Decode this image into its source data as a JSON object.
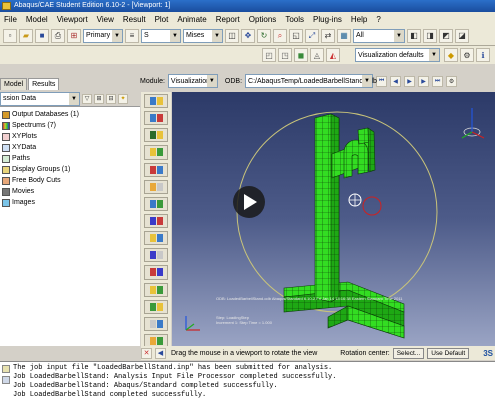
{
  "window": {
    "title": "Abaqus/CAE Student Edition 6.10-2 - [Viewport: 1]"
  },
  "menu": {
    "items": [
      "File",
      "Model",
      "Viewport",
      "View",
      "Result",
      "Plot",
      "Animate",
      "Report",
      "Options",
      "Tools",
      "Plug-ins",
      "Help",
      "?"
    ]
  },
  "toolbar": {
    "step_combo": "Primary",
    "frame_combo": "S",
    "field_combo": "Mises",
    "render_combo": "All",
    "viz_defaults": "Visualization defaults"
  },
  "context": {
    "module_label": "Module:",
    "module_value": "Visualization",
    "odb_label": "ODB:",
    "odb_value": "C:/AbaqusTemp/LoadedBarbellStand.odb"
  },
  "left_panel": {
    "tabs": [
      "Model",
      "Results"
    ],
    "active_tab": "Results",
    "selector_value": "ssion Data",
    "tree": [
      {
        "label": "Output Databases (1)",
        "icon": "database-icon",
        "color": "#d49a2a"
      },
      {
        "label": "Spectrums (7)",
        "icon": "spectrum-icon",
        "color": "#7a5cc4"
      },
      {
        "label": "XYPlots",
        "icon": "xyplot-icon",
        "color": "#c83a3a"
      },
      {
        "label": "XYData",
        "icon": "xydata-icon",
        "color": "#3a7ac8"
      },
      {
        "label": "Paths",
        "icon": "path-icon",
        "color": "#4aa04a"
      },
      {
        "label": "Display Groups (1)",
        "icon": "display-group-icon",
        "color": "#d4b02a"
      },
      {
        "label": "Free Body Cuts",
        "icon": "free-body-icon",
        "color": "#c86a2a"
      },
      {
        "label": "Movies",
        "icon": "movie-icon",
        "color": "#5a5a5a"
      },
      {
        "label": "Images",
        "icon": "image-icon",
        "color": "#2a9ac8"
      }
    ]
  },
  "viewport": {
    "legend_text": "ODB: LoadedBarbellStand.odb    Abaqus/Standard 6.10-2    Fri Jan 14 13:16:38 Eastern Standard Time 2011",
    "step_text": "Step: LoadingStep",
    "increment_text": "Increment    1: Step Time =    1.000",
    "mesh_color": "#33dd22"
  },
  "prompt": {
    "text": "Drag the mouse in a viewport to rotate the view",
    "rotation_label": "Rotation center:",
    "select_button": "Select...",
    "default_button": "Use Default"
  },
  "messages": [
    "The job input file \"LoadedBarbellStand.inp\" has been submitted for analysis.",
    "Job LoadedBarbellStand: Analysis Input File Processor completed successfully.",
    "Job LoadedBarbellStand: Abaqus/Standard completed successfully.",
    "Job LoadedBarbellStand completed successfully."
  ]
}
